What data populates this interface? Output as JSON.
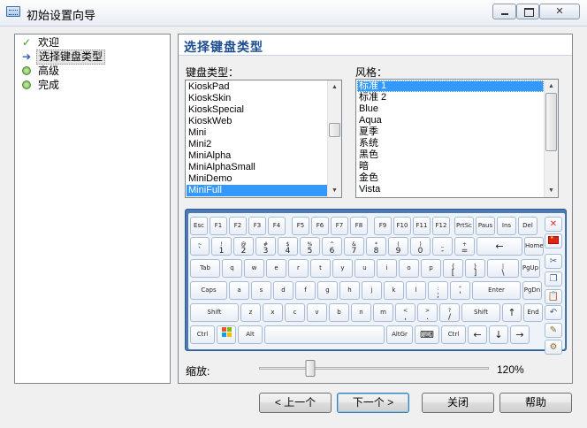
{
  "window": {
    "title": "初始设置向导",
    "controls": {
      "minimize": "",
      "maximize": "",
      "close": "✕"
    }
  },
  "nav": {
    "items": [
      {
        "label": "欢迎",
        "icon": "check-icon",
        "state": "done"
      },
      {
        "label": "选择键盘类型",
        "icon": "arrow-right-icon",
        "state": "current"
      },
      {
        "label": "高级",
        "icon": "bullet-icon",
        "state": "pending"
      },
      {
        "label": "完成",
        "icon": "bullet-icon",
        "state": "pending"
      }
    ]
  },
  "page": {
    "heading": "选择键盘类型",
    "keyboard_type_label": "键盘类型：",
    "style_label": "风格：",
    "keyboard_types": [
      "KioskPad",
      "KioskSkin",
      "KioskSpecial",
      "KioskWeb",
      "Mini",
      "Mini2",
      "MiniAlpha",
      "MiniAlphaSmall",
      "MiniDemo",
      "MiniFull"
    ],
    "keyboard_type_selected": "MiniFull",
    "keyboard_types_scroll_position": 0.38,
    "styles": [
      "标准 1",
      "标准 2",
      "Blue",
      "Aqua",
      "夏季",
      "系统",
      "黑色",
      "暗",
      "金色",
      "Vista"
    ],
    "style_selected": "标准 1",
    "styles_scroll_position": 0.0,
    "zoom_label": "缩放:",
    "zoom_value": "120%",
    "zoom_fraction": 0.22
  },
  "keyboard": {
    "rows": [
      [
        {
          "b": "Esc",
          "w": 20
        },
        {
          "b": "F1",
          "w": 20
        },
        {
          "b": "F2",
          "w": 20
        },
        {
          "b": "F3",
          "w": 20
        },
        {
          "b": "F4",
          "w": 20,
          "gap": 5
        },
        {
          "b": "F5",
          "w": 20
        },
        {
          "b": "F6",
          "w": 20
        },
        {
          "b": "F7",
          "w": 20
        },
        {
          "b": "F8",
          "w": 20,
          "gap": 5
        },
        {
          "b": "F9",
          "w": 20
        },
        {
          "b": "F10",
          "w": 20
        },
        {
          "b": "F11",
          "w": 20
        },
        {
          "b": "F12",
          "w": 20,
          "gap": 3
        },
        {
          "b": "PrtSc",
          "w": 22
        },
        {
          "b": "Paus",
          "w": 22
        },
        {
          "b": "Ins",
          "w": 22
        },
        {
          "b": "Del",
          "w": 22
        }
      ],
      [
        {
          "t": "~",
          "b": "`",
          "w": 22
        },
        {
          "t": "!",
          "b": "1"
        },
        {
          "t": "@",
          "b": "2"
        },
        {
          "t": "#",
          "b": "3"
        },
        {
          "t": "$",
          "b": "4"
        },
        {
          "t": "%",
          "b": "5"
        },
        {
          "t": "^",
          "b": "6"
        },
        {
          "t": "&",
          "b": "7"
        },
        {
          "t": "*",
          "b": "8"
        },
        {
          "t": "(",
          "b": "9"
        },
        {
          "t": ")",
          "b": "0"
        },
        {
          "t": "_",
          "b": "-"
        },
        {
          "t": "+",
          "b": "="
        },
        {
          "g": "←",
          "w": 52
        },
        {
          "b": "Home",
          "w": 22
        }
      ],
      [
        {
          "b": "Tab",
          "w": 34
        },
        {
          "b": "q"
        },
        {
          "b": "w"
        },
        {
          "b": "e"
        },
        {
          "b": "r"
        },
        {
          "b": "t"
        },
        {
          "b": "y"
        },
        {
          "b": "u"
        },
        {
          "b": "i"
        },
        {
          "b": "o"
        },
        {
          "b": "p"
        },
        {
          "t": "{",
          "b": "["
        },
        {
          "t": "}",
          "b": "]"
        },
        {
          "t": "|",
          "b": "\\",
          "w": 36
        },
        {
          "b": "PgUp",
          "w": 22
        }
      ],
      [
        {
          "b": "Caps",
          "w": 42
        },
        {
          "b": "a"
        },
        {
          "b": "s"
        },
        {
          "b": "d"
        },
        {
          "b": "f"
        },
        {
          "b": "g"
        },
        {
          "b": "h"
        },
        {
          "b": "j"
        },
        {
          "b": "k"
        },
        {
          "b": "l"
        },
        {
          "t": ":",
          "b": ";"
        },
        {
          "t": "\"",
          "b": "'"
        },
        {
          "b": "Enter",
          "w": 55
        },
        {
          "b": "PgDn",
          "w": 22
        }
      ],
      [
        {
          "b": "Shift",
          "w": 55
        },
        {
          "b": "z"
        },
        {
          "b": "x"
        },
        {
          "b": "c"
        },
        {
          "b": "v"
        },
        {
          "b": "b"
        },
        {
          "b": "n"
        },
        {
          "b": "m"
        },
        {
          "t": "<",
          "b": ","
        },
        {
          "t": ">",
          "b": "."
        },
        {
          "t": "?",
          "b": "/"
        },
        {
          "b": "Shift",
          "w": 44
        },
        {
          "g": "↑",
          "w": 22
        },
        {
          "b": "End",
          "w": 22
        }
      ],
      [
        {
          "b": "Ctrl",
          "w": 28
        },
        {
          "win": true,
          "w": 22
        },
        {
          "b": "Alt",
          "w": 28
        },
        {
          "b": "",
          "w": 136
        },
        {
          "b": "AltGr",
          "w": 30
        },
        {
          "g": "⌨",
          "w": 28
        },
        {
          "b": "Ctrl",
          "w": 28
        },
        {
          "g": "←",
          "w": 22
        },
        {
          "g": "↓",
          "w": 22
        },
        {
          "g": "→",
          "w": 22
        }
      ]
    ],
    "side": [
      {
        "name": "close-keyboard-icon",
        "g": "✕",
        "color": "#d9332b"
      },
      {
        "name": "english-flag-icon",
        "flag": "en"
      },
      {
        "name": "cut-icon",
        "g": "✂",
        "color": "#3a5f9a"
      },
      {
        "name": "copy-icon",
        "g": "❐",
        "color": "#3a5f9a"
      },
      {
        "name": "paste-icon",
        "g": "📋",
        "color": "#8a6a2a"
      },
      {
        "name": "undo-icon",
        "g": "↶",
        "color": "#3a5f9a"
      },
      {
        "name": "edit-icon",
        "g": "✎",
        "color": "#8a6a2a"
      },
      {
        "name": "settings-icon",
        "g": "⚙",
        "color": "#8a6a2a"
      }
    ]
  },
  "buttons": {
    "back": "< 上一个",
    "next": "下一个 >",
    "close": "关闭",
    "help": "帮助"
  },
  "colors": {
    "heading": "#1b4d91",
    "selection": "#3399ff",
    "keyboard_frame": "#4b79b4"
  }
}
